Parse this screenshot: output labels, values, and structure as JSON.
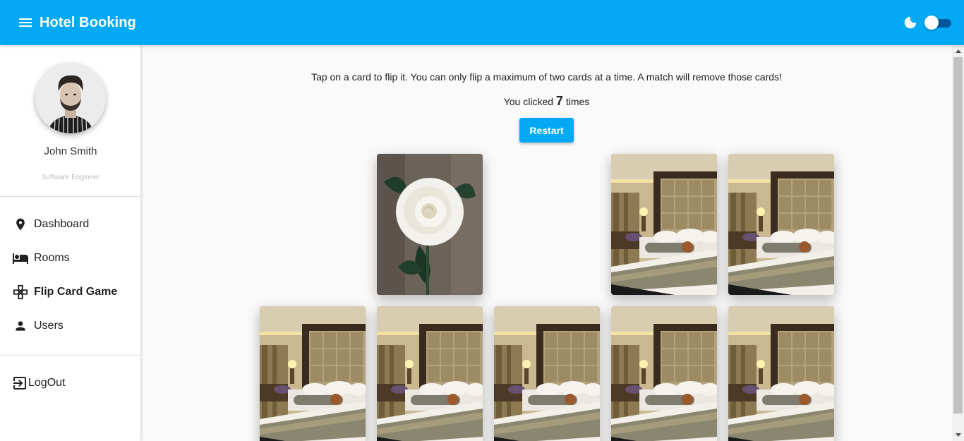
{
  "app": {
    "title": "Hotel Booking"
  },
  "header": {
    "menu_icon": "menu-icon",
    "theme_icon": "moon-icon",
    "theme_toggle_on": false
  },
  "profile": {
    "name": "John Smith",
    "role": "Software Engineer"
  },
  "sidebar": {
    "items": [
      {
        "label": "Dashboard",
        "icon": "location-pin-icon",
        "active": false
      },
      {
        "label": "Rooms",
        "icon": "bed-icon",
        "active": false
      },
      {
        "label": "Flip Card Game",
        "icon": "game-controller-icon",
        "active": true
      },
      {
        "label": "Users",
        "icon": "person-icon",
        "active": false
      }
    ],
    "logout_label": "LogOut"
  },
  "game": {
    "instructions": "Tap on a card to flip it. You can only flip a maximum of two cards at a time. A match will remove those cards!",
    "clicks_prefix": "You clicked",
    "clicks_count": "7",
    "clicks_suffix": "times",
    "restart_label": "Restart",
    "cards_row1": [
      "rose-face-up",
      "removed",
      "hotel-room-face-down",
      "hotel-room-face-down"
    ],
    "cards_row2": [
      "hotel-room-face-down",
      "hotel-room-face-down",
      "hotel-room-face-down",
      "hotel-room-face-down",
      "hotel-room-face-down"
    ]
  },
  "colors": {
    "accent": "#03a9f4",
    "toggle_track": "#01579b"
  }
}
